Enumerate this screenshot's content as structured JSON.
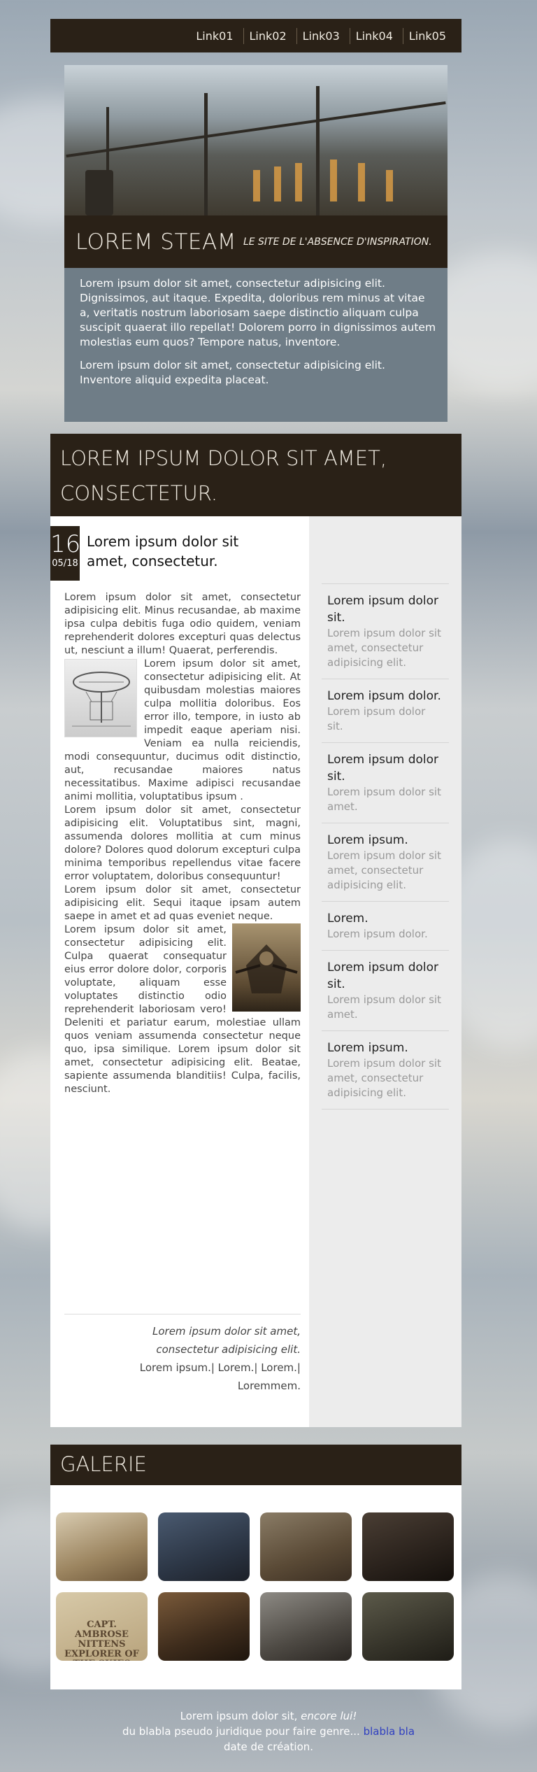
{
  "nav": {
    "links": [
      "Link01",
      "Link02",
      "Link03",
      "Link04",
      "Link05"
    ]
  },
  "hero": {
    "title": "LOREM STEAM",
    "tagline": "Le site de l'absence d'inspiration.",
    "paragraphs": [
      "Lorem ipsum dolor sit amet, consectetur adipisicing elit. Dignissimos, aut itaque. Expedita, doloribus rem minus at vitae a, veritatis nostrum laboriosam saepe distinctio aliquam culpa suscipit quaerat illo repellat! Dolorem porro in dignissimos autem molestias eum quos? Tempore natus, inventore.",
      "Lorem ipsum dolor sit amet, consectetur adipisicing elit. Inventore aliquid expedita placeat."
    ]
  },
  "main": {
    "heading": "Lorem ipsum dolor sit amet, consectetur.",
    "date": {
      "day": "16",
      "month_year": "05/18"
    },
    "article_title": "Lorem ipsum dolor sit amet, consectetur.",
    "paragraphs": [
      "Lorem ipsum dolor sit amet, consectetur adipisicing elit. Minus recusandae, ab maxime ipsa culpa debitis fuga odio quidem, veniam reprehenderit dolores excepturi quas delectus ut, nesciunt a illum! Quaerat, perferendis.",
      "Lorem ipsum dolor sit amet, consectetur adipisicing elit. At quibusdam molestias maiores culpa mollitia doloribus. Eos error illo, tempore, in iusto ab impedit eaque aperiam nisi. Veniam ea nulla reiciendis, modi consequuntur, ducimus odit distinctio, aut, recusandae maiores natus necessitatibus. Maxime adipisci recusandae animi mollitia, voluptatibus ipsum .",
      "Lorem ipsum dolor sit amet, consectetur adipisicing elit. Voluptatibus sint, magni, assumenda dolores mollitia at cum minus dolore? Dolores quod dolorum excepturi culpa minima temporibus repellendus vitae facere error voluptatem, doloribus consequuntur!",
      "Lorem ipsum dolor sit amet, consectetur adipisicing elit. Sequi itaque ipsam autem saepe in amet et ad quas eveniet neque.",
      "Lorem ipsum dolor sit amet, consectetur adipisicing elit. Culpa quaerat consequatur eius error dolore dolor, corporis voluptate, aliquam esse voluptates distinctio odio reprehenderit laboriosam vero! Deleniti et pariatur earum, molestiae ullam quos veniam assumenda consectetur neque quo, ipsa similique. Lorem ipsum dolor sit amet, consectetur adipisicing elit. Beatae, sapiente assumenda blanditiis! Culpa, facilis, nesciunt."
    ],
    "quote": {
      "text": "Lorem ipsum dolor sit amet, consectetur adipisicing elit.",
      "source": "Lorem ipsum.| Lorem.| Lorem.| Loremmem."
    }
  },
  "sidebar": {
    "items": [
      {
        "title": "Lorem ipsum dolor sit.",
        "sub": "Lorem ipsum dolor sit amet, consectetur adipisicing elit."
      },
      {
        "title": "Lorem ipsum dolor.",
        "sub": "Lorem ipsum dolor sit."
      },
      {
        "title": "Lorem ipsum dolor sit.",
        "sub": "Lorem ipsum dolor sit amet."
      },
      {
        "title": "Lorem ipsum.",
        "sub": "Lorem ipsum dolor sit amet, consectetur adipisicing elit."
      },
      {
        "title": "Lorem.",
        "sub": "Lorem ipsum dolor."
      },
      {
        "title": "Lorem ipsum dolor sit.",
        "sub": "Lorem ipsum dolor sit amet."
      },
      {
        "title": "Lorem ipsum.",
        "sub": "Lorem ipsum dolor sit amet, consectetur adipisicing elit."
      }
    ]
  },
  "gallery": {
    "title": "GALERIE",
    "poster_text": "CAPT. AMBROSE NITTENS EXPLORER OF THE SKIES AND SEAS"
  },
  "footer": {
    "line1": "Lorem ipsum dolor sit,",
    "line1_em": "encore lui!",
    "line2": "du blabla pseudo juridique pour faire genre...",
    "link": "blabla bla",
    "line3": "date de création."
  },
  "colors": {
    "dark_brown": "#2a2117",
    "cream": "#f1ece2",
    "sidebar_bg": "#ececec",
    "link_blue": "#3040c0"
  }
}
